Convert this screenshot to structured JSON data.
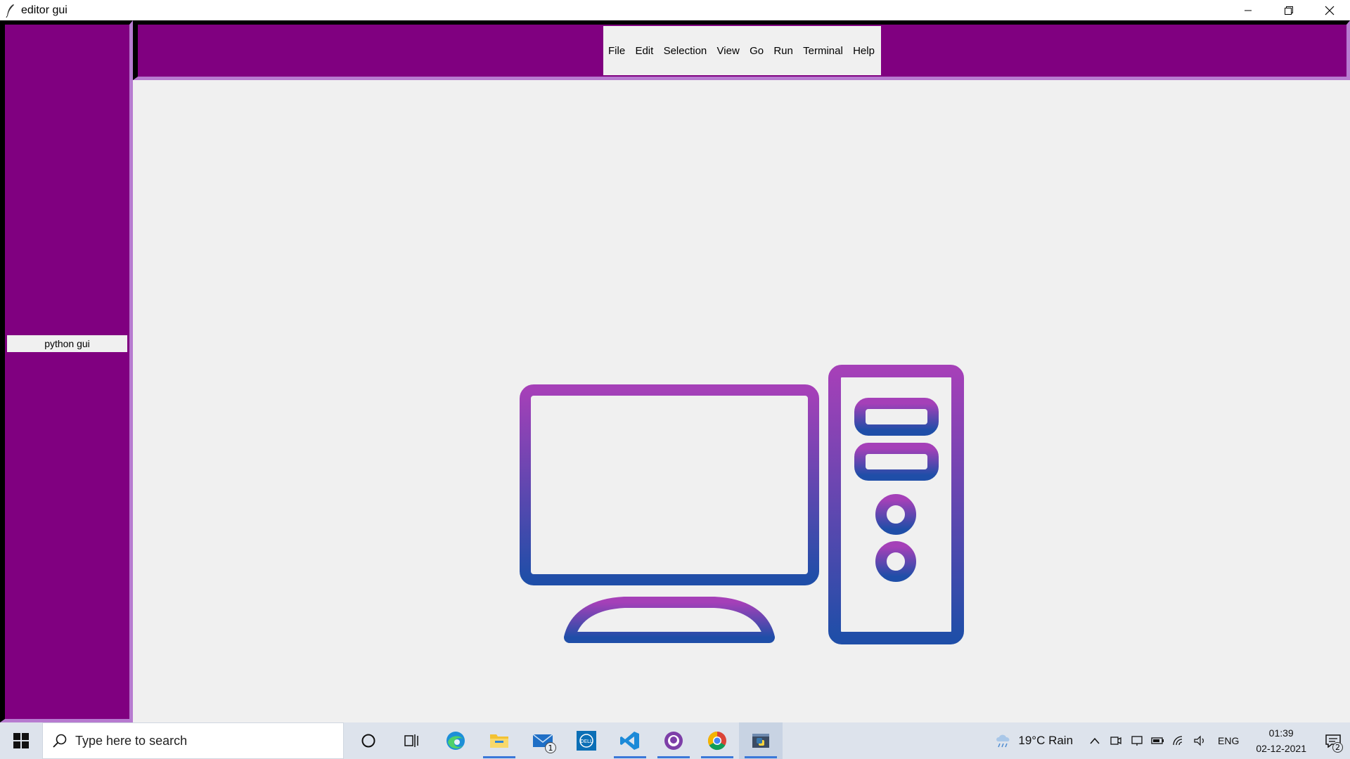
{
  "window": {
    "title": "editor gui",
    "app_icon": "feather-icon",
    "controls": [
      "minimize-icon",
      "restore-icon",
      "close-icon"
    ]
  },
  "sidebar": {
    "background": "#800080",
    "label": "python gui"
  },
  "topbar": {
    "background": "#800080",
    "menu": [
      "File",
      "Edit",
      "Selection",
      "View",
      "Go",
      "Run",
      "Terminal",
      "Help"
    ]
  },
  "illustration": {
    "name": "desktop-computer-icon",
    "gradient_top": "#a540b8",
    "gradient_bottom": "#1f4ea8"
  },
  "taskbar": {
    "search_placeholder": "Type here to search",
    "apps": [
      {
        "name": "cortana-icon"
      },
      {
        "name": "task-view-icon"
      },
      {
        "name": "edge-icon"
      },
      {
        "name": "file-explorer-icon",
        "running": true
      },
      {
        "name": "mail-icon",
        "badge": "1"
      },
      {
        "name": "dell-icon"
      },
      {
        "name": "vscode-icon",
        "running": true
      },
      {
        "name": "github-desktop-icon",
        "running": true
      },
      {
        "name": "chrome-icon",
        "running": true
      },
      {
        "name": "python-app-icon",
        "running": true,
        "active": true
      }
    ],
    "weather": "19°C  Rain",
    "language": "ENG",
    "time": "01:39",
    "date": "02-12-2021",
    "notifications": "2"
  }
}
